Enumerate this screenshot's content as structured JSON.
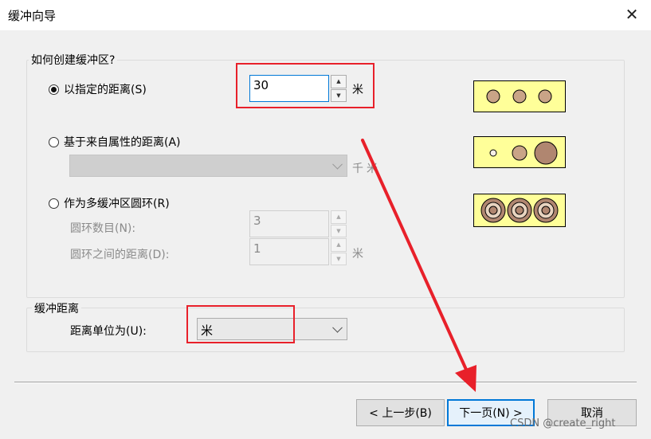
{
  "window": {
    "title": "缓冲向导",
    "close_glyph": "✕"
  },
  "group_how": {
    "legend": "如何创建缓冲区?",
    "option_distance": {
      "label": "以指定的距离(S)",
      "checked": true,
      "value": "30",
      "unit": "米"
    },
    "option_attribute": {
      "label": "基于来自属性的距离(A)",
      "checked": false,
      "select_value": "",
      "unit": "千米"
    },
    "option_rings": {
      "label": "作为多缓冲区圆环(R)",
      "checked": false,
      "ring_count_label": "圆环数目(N):",
      "ring_count_value": "3",
      "ring_distance_label": "圆环之间的距离(D):",
      "ring_distance_value": "1",
      "unit": "米"
    }
  },
  "group_distance": {
    "legend": "缓冲距离",
    "unit_label": "距离单位为(U):",
    "unit_value": "米"
  },
  "buttons": {
    "back": "< 上一步(B)",
    "next": "下一页(N) >",
    "cancel": "取消"
  },
  "watermark": "CSDN @create_right",
  "colors": {
    "preview_bg": "#ffff99",
    "circle": "#c9a487",
    "circle_dark": "#b08670",
    "ring_light": "#e8d4c0",
    "annotation": "#e8202a"
  },
  "icons": {
    "spin_up": "▲",
    "spin_down": "▼"
  }
}
